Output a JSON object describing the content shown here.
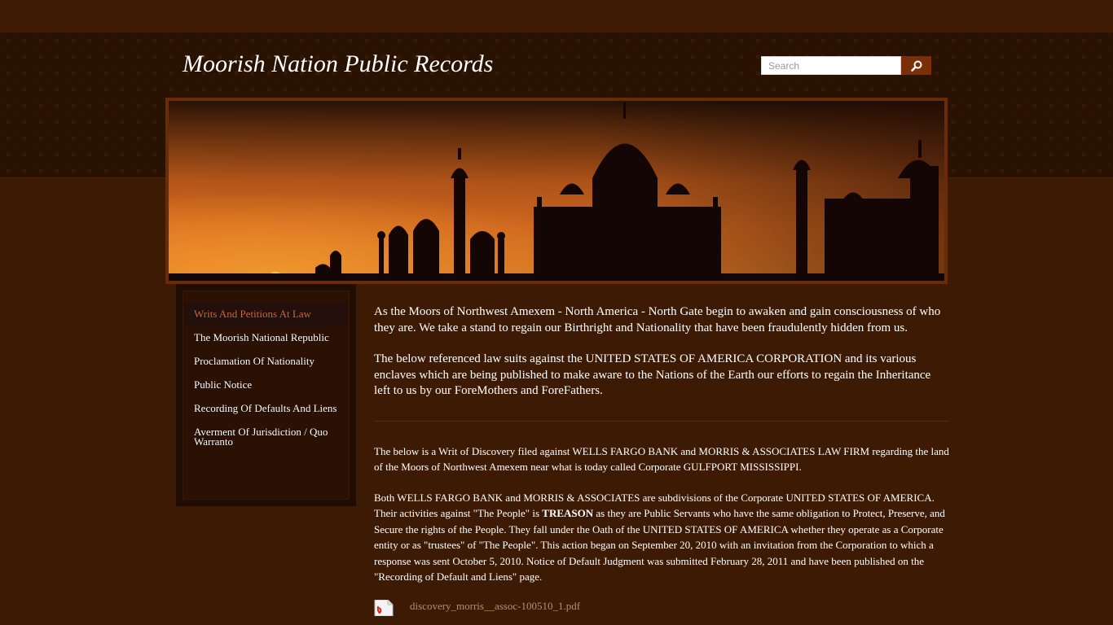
{
  "site": {
    "title": "Moorish Nation Public Records"
  },
  "search": {
    "placeholder": "Search"
  },
  "nav": {
    "items": [
      {
        "label": "Writs And Petitions At Law",
        "active": true
      },
      {
        "label": "The Moorish National Republic"
      },
      {
        "label": "Proclamation Of Nationality"
      },
      {
        "label": "Public Notice"
      },
      {
        "label": "Recording Of Defaults And Liens"
      },
      {
        "label": "Averment Of Jurisdiction / Quo Warranto"
      }
    ]
  },
  "content": {
    "intro1": "As the Moors of Northwest Amexem - North America - North Gate begin to awaken and gain consciousness of who they are. We take a stand to regain our Birthright and Nationality that have been fraudulently hidden from us.",
    "intro2": "The below referenced law suits against the UNITED STATES OF AMERICA CORPORATION and its various enclaves which are being published to make aware to the Nations of the Earth our efforts to regain the Inheritance left to us by our ForeMothers and ForeFathers.",
    "para1": "The below is a Writ of Discovery filed against WELLS FARGO BANK and MORRIS & ASSOCIATES LAW FIRM regarding the land of the Moors of Northwest Amexem near what is today called Corporate GULFPORT MISSISSIPPI.",
    "para2_before": "Both WELLS FARGO BANK and MORRIS & ASSOCIATES are subdivisions of the Corporate UNITED STATES OF AMERICA. Their activities against \"The People\" is ",
    "para2_bold": "TREASON",
    "para2_after": " as they are Public Servants who have the same obligation to Protect, Preserve, and Secure the rights of the People. They fall under the Oath of the UNITED STATES OF AMERICA whether they operate as a Corporate entity or as \"trustees\" of \"The People\". This action began on September 20, 2010 with an invitation from the Corporation to which a response was sent October 5, 2010. Notice of Default Judgment was submitted February 28, 2011 and have been published on the \"Recording of Default and Liens\" page.",
    "file_name": "discovery_morris__assoc-100510_1.pdf",
    "file_icon": "pdf-file-icon"
  },
  "colors": {
    "background": "#3d1a04",
    "header_band": "#2a1203",
    "active_nav": "#cc6a44",
    "search_button": "#7a2f06",
    "file_link": "#b98e6a"
  }
}
